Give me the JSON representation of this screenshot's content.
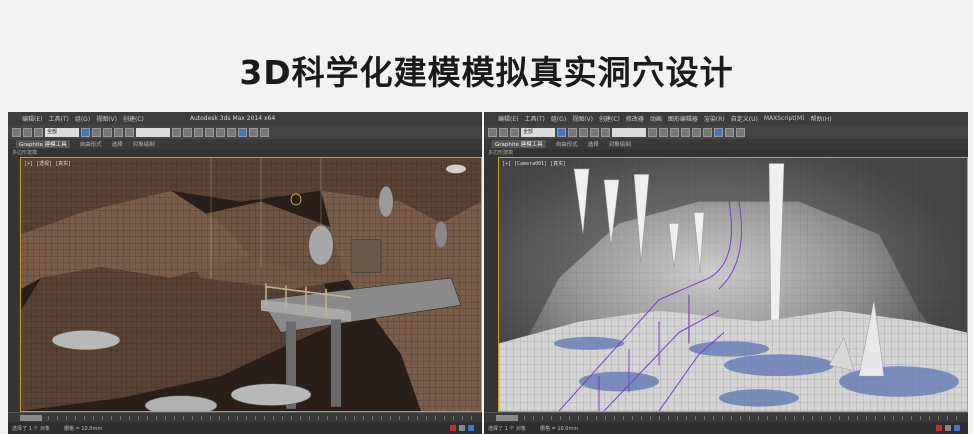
{
  "banner": {
    "title": "3D科学化建模模拟真实洞穴设计"
  },
  "left_window": {
    "menu": [
      "编辑(E)",
      "工具(T)",
      "组(G)",
      "视图(V)",
      "创建(C)"
    ],
    "title_text": "Autodesk 3ds Max  2014 x64",
    "selection_set": "全部",
    "ribbon": [
      "Graphite 建模工具",
      "自由形式",
      "选择",
      "对象绘制"
    ],
    "ribbon_active": 0,
    "subribbon": "多边形建模",
    "viewport_label": "[+] [透视] [真实]",
    "status": [
      "选择了 1 个 对象",
      "栅格 = 10.0mm"
    ]
  },
  "right_window": {
    "menu": [
      "编辑(E)",
      "工具(T)",
      "组(G)",
      "视图(V)",
      "创建(C)",
      "修改器",
      "动画",
      "图形编辑器",
      "渲染(R)",
      "自定义(U)",
      "MAXScript(M)",
      "帮助(H)"
    ],
    "selection_set": "全部",
    "ribbon": [
      "Graphite 建模工具",
      "自由形式",
      "选择",
      "对象绘制"
    ],
    "ribbon_active": 0,
    "subribbon": "多边形建模",
    "viewport_label": "[+] [Camera001] [真实]",
    "status": [
      "选择了 1 个 对象",
      "栅格 = 10.0mm"
    ]
  },
  "colors": {
    "viewport_border": "#c9a227",
    "app_accent": "#3a78c8",
    "water": "#6a7fb5",
    "railing": "#7a3fc8"
  },
  "icons": [
    "app-logo-icon",
    "select-tool-icon",
    "move-tool-icon",
    "rotate-tool-icon",
    "scale-tool-icon",
    "render-icon",
    "key-icon"
  ]
}
